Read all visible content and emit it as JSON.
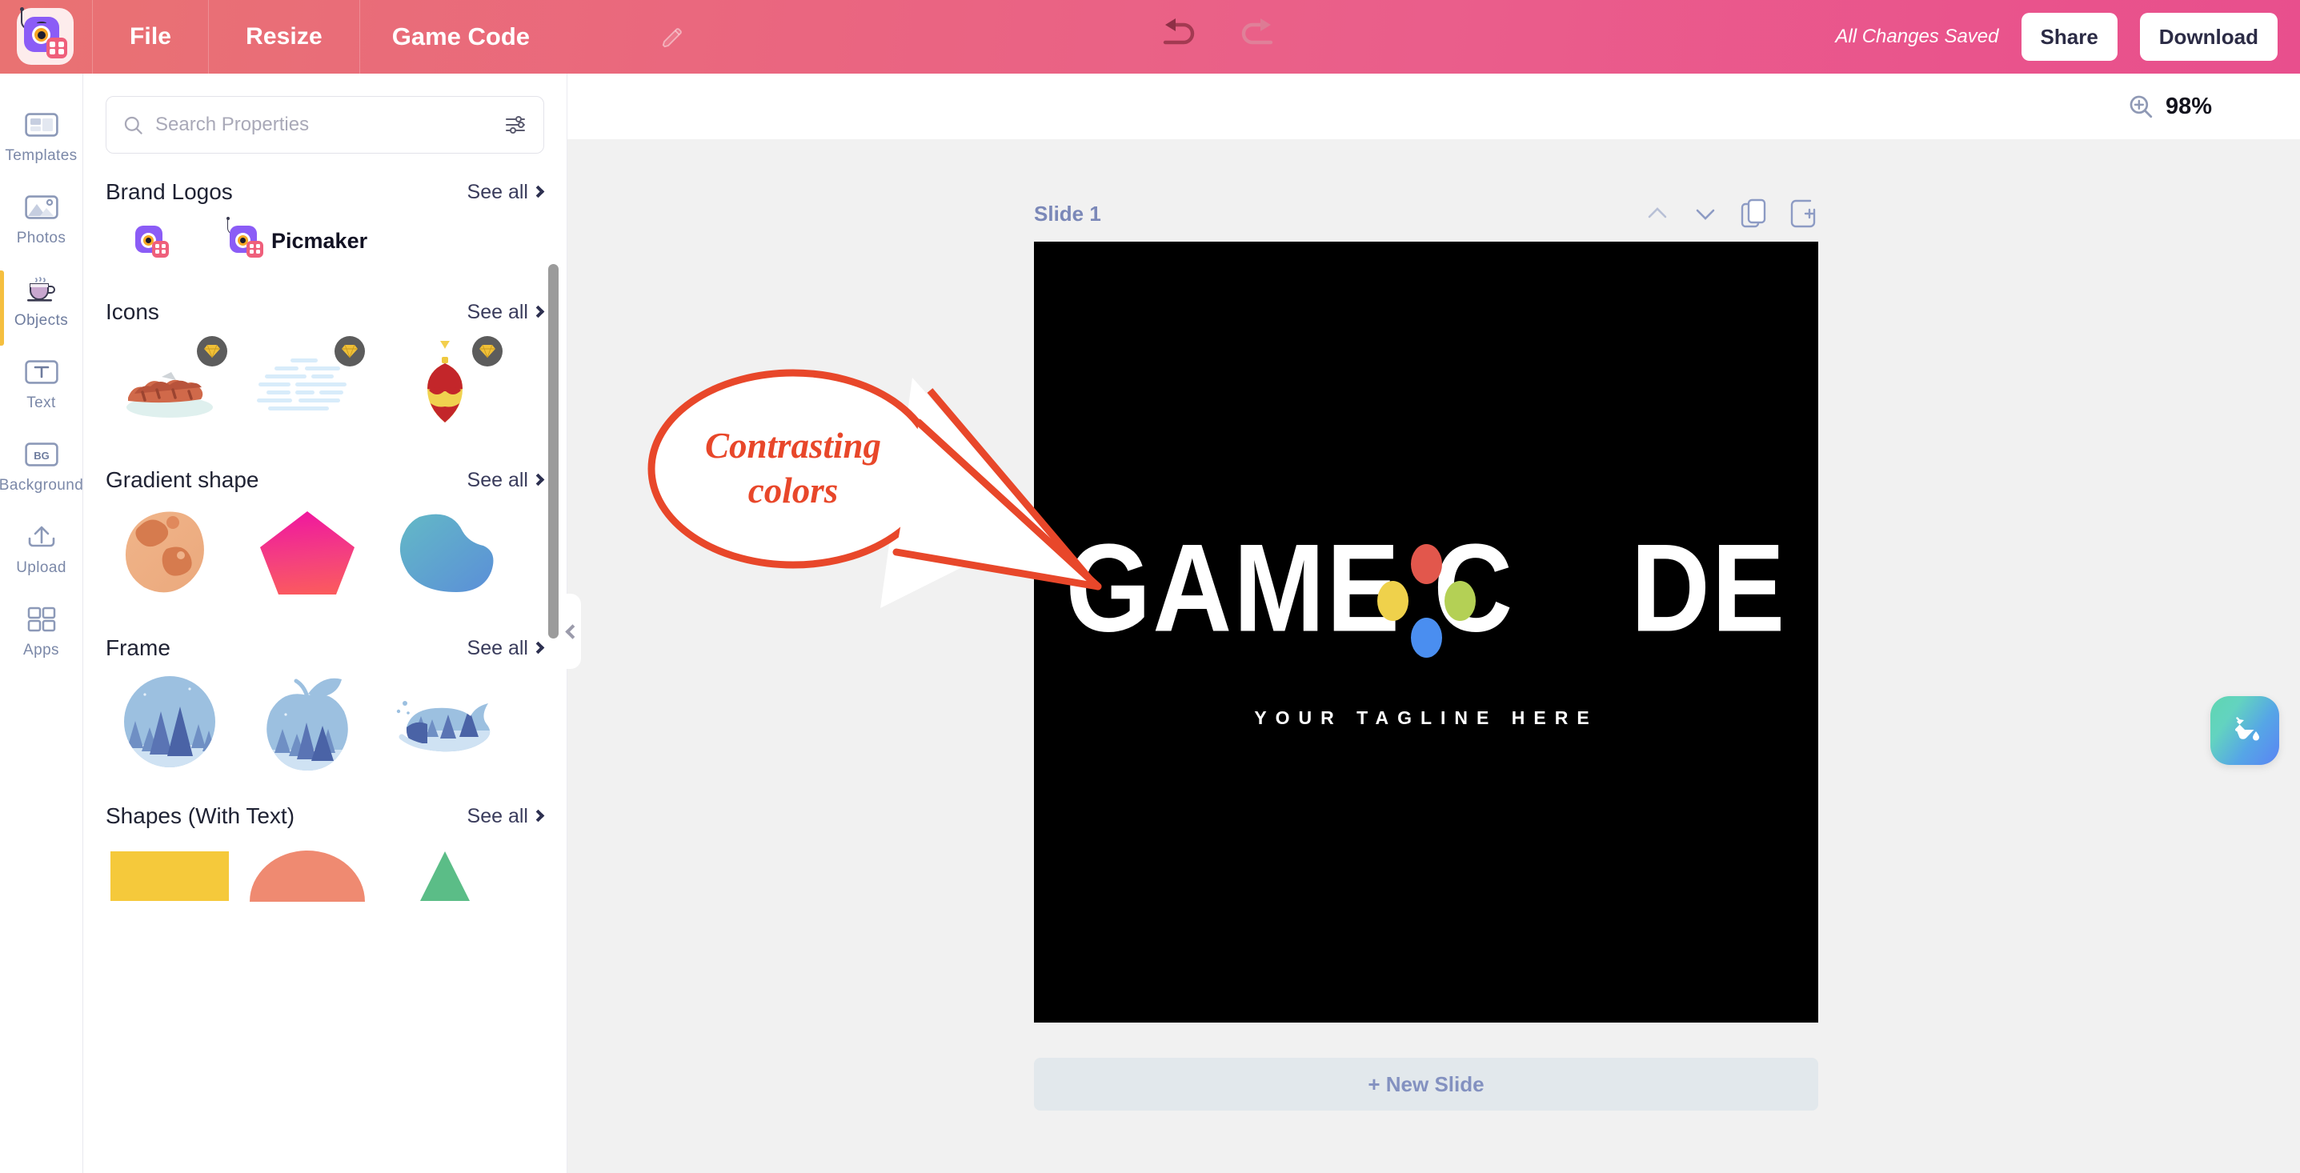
{
  "header": {
    "logo_icon": "picmaker-logo-icon",
    "menus": [
      {
        "label": "File",
        "name": "file-menu"
      },
      {
        "label": "Resize",
        "name": "resize-menu"
      }
    ],
    "project_title": "Game Code",
    "edit_title_icon": "pencil-icon",
    "undo_icon": "undo-icon",
    "redo_icon": "redo-icon",
    "save_status": "All Changes Saved",
    "share_label": "Share",
    "download_label": "Download"
  },
  "rail": {
    "items": [
      {
        "label": "Templates",
        "name": "sidebar-item-templates",
        "icon": "templates-icon",
        "active": false
      },
      {
        "label": "Photos",
        "name": "sidebar-item-photos",
        "icon": "photos-icon",
        "active": false
      },
      {
        "label": "Objects",
        "name": "sidebar-item-objects",
        "icon": "objects-cup-icon",
        "active": true
      },
      {
        "label": "Text",
        "name": "sidebar-item-text",
        "icon": "text-icon",
        "active": false
      },
      {
        "label": "Background",
        "name": "sidebar-item-background",
        "icon": "background-bg-icon",
        "active": false
      },
      {
        "label": "Upload",
        "name": "sidebar-item-upload",
        "icon": "upload-icon",
        "active": false
      },
      {
        "label": "Apps",
        "name": "sidebar-item-apps",
        "icon": "apps-grid-icon",
        "active": false
      }
    ]
  },
  "panel": {
    "search": {
      "placeholder": "Search Properties",
      "value": "",
      "search_icon": "search-icon",
      "filter_icon": "filter-sliders-icon"
    },
    "see_all_label": "See all",
    "sections": [
      {
        "title": "Brand Logos",
        "name": "section-brand-logos",
        "items": [
          {
            "name": "brand-logo-mark",
            "label": ""
          },
          {
            "name": "brand-logo-full",
            "label": "Picmaker"
          }
        ]
      },
      {
        "title": "Icons",
        "name": "section-icons",
        "items": [
          {
            "name": "icon-thumb-sausages",
            "pro": true
          },
          {
            "name": "icon-thumb-clouds",
            "pro": true
          },
          {
            "name": "icon-thumb-ornament",
            "pro": true
          }
        ]
      },
      {
        "title": "Gradient shape",
        "name": "section-gradient-shape",
        "items": [
          {
            "name": "gradient-shape-blob-orange",
            "pro": false
          },
          {
            "name": "gradient-shape-pentagon-pink",
            "pro": false
          },
          {
            "name": "gradient-shape-blob-blue",
            "pro": false
          }
        ]
      },
      {
        "title": "Frame",
        "name": "section-frame",
        "items": [
          {
            "name": "frame-circle-forest",
            "pro": false
          },
          {
            "name": "frame-apple-forest",
            "pro": false
          },
          {
            "name": "frame-whale-forest",
            "pro": false
          }
        ]
      },
      {
        "title": "Shapes (With Text)",
        "name": "section-shapes-with-text",
        "items": [
          {
            "name": "shape-rectangle-yellow",
            "pro": false
          },
          {
            "name": "shape-semicircle-salmon",
            "pro": false
          },
          {
            "name": "shape-triangle-green",
            "pro": false
          }
        ]
      }
    ],
    "collapse_icon": "chevron-left-icon"
  },
  "workspace": {
    "zoom": {
      "icon": "zoom-in-icon",
      "value": "98%"
    },
    "slide": {
      "label": "Slide 1",
      "tools": [
        {
          "name": "move-slide-up-button",
          "icon": "chevron-up-icon"
        },
        {
          "name": "move-slide-down-button",
          "icon": "chevron-down-icon"
        },
        {
          "name": "duplicate-slide-button",
          "icon": "duplicate-icon"
        },
        {
          "name": "add-slide-button",
          "icon": "add-page-icon"
        }
      ]
    },
    "new_slide_label": "+ New Slide",
    "fill_button_icon": "paint-bucket-icon"
  },
  "canvas": {
    "background_color": "#000000",
    "wordmark_part1": "GAME C",
    "wordmark_part2": "DE",
    "tagline": "YOUR TAGLINE HERE",
    "dot_colors": {
      "top": "#e2574c",
      "left": "#efd14b",
      "right": "#b4d055",
      "bottom": "#4a8ef0"
    }
  },
  "annotation": {
    "line1": "Contrasting",
    "line2": "colors",
    "color": "#e8472a"
  }
}
